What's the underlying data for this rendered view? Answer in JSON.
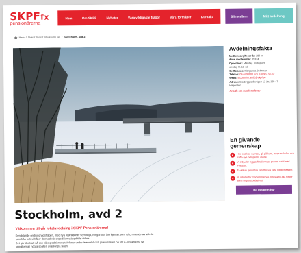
{
  "header": {
    "logo_main": "SKPF",
    "logo_fx": "fx",
    "logo_sub": "pensionärerna",
    "nav": [
      {
        "label": "Hem"
      },
      {
        "label": "Om SKPF"
      },
      {
        "label": "Nyheter"
      },
      {
        "label": "Våra viktigaste frågor"
      },
      {
        "label": "Våra förmåner"
      },
      {
        "label": "Kontakt"
      }
    ],
    "members_button": "Bli medlem",
    "join_button": "Mitt avdelning"
  },
  "breadcrumb": {
    "items": [
      "Hem",
      "Skärst Skärst Stockholm län"
    ],
    "current": "Stockholm, avd 2"
  },
  "hero": {
    "alt": "Winter lake with frozen water, bridge and bare trees",
    "colors": {
      "sky_top": "#7f9fb5",
      "sky_bottom": "#f3d9c3",
      "ice": "#e9eef3",
      "reeds": "#b79a6e"
    }
  },
  "page": {
    "title": "Stockholm, avd 2",
    "welcome": "Välkommen till vår lokalavdelning i SKPF Pensionärerna!",
    "body": [
      "Den bilande ombyggnadsfrågen, med nya restriktioner som följd, tvingar oss återigen att som rekommenderas arbeta",
      "hemifrån och vi håller därmed vår expedition stängd tills vidare.",
      "Det går dock att nå oss på expeditionens telefoner under telefontid och givetvis även på vår e-postadress. Se",
      "uppgifterna i högra spalten ovanför på sidan)"
    ]
  },
  "facts": {
    "heading": "Avdelningsfakta",
    "rows": [
      {
        "label": "Medlemsavgift per år:",
        "value": " 280 kr"
      },
      {
        "label": "Antal medlemmar:",
        "value": " 19324"
      },
      {
        "label": "Öppettider:",
        "value": " Måndag, tisdag och"
      },
      {
        "label": "",
        "value": "onsdag kl. 10-12"
      },
      {
        "label": "Ordförande:",
        "value": " Margareta Behrman"
      },
      {
        "label": "Telefon:",
        "value": " 08-6700000 och 070 924 95 37"
      },
      {
        "label": "Webb:",
        "value": " stockholm.avd2@skpf.se"
      },
      {
        "label": "Adress:",
        "value": " Storbyggnadsvägen 12 1tr, 129 47"
      },
      {
        "label": "",
        "value": "Hägersten"
      }
    ],
    "link": "Ansök om medlemsbrev"
  },
  "gemenskap": {
    "heading_line1": "En givande",
    "heading_line2": "gemenskap",
    "items": [
      "Hos oss kan du resa, gå på kurs, mysa av kultur och träffa nya och gamla vänner",
      "Vi erbjuder trygga försäkringar genom avtal med Folksam.",
      "Ta del av generösa rabatter via våra medlemssidor.",
      "Vi arbetar för medlemmarnas intressen i alla frågor som rör pensionärslivet!"
    ],
    "button": "Bli medlem här"
  }
}
